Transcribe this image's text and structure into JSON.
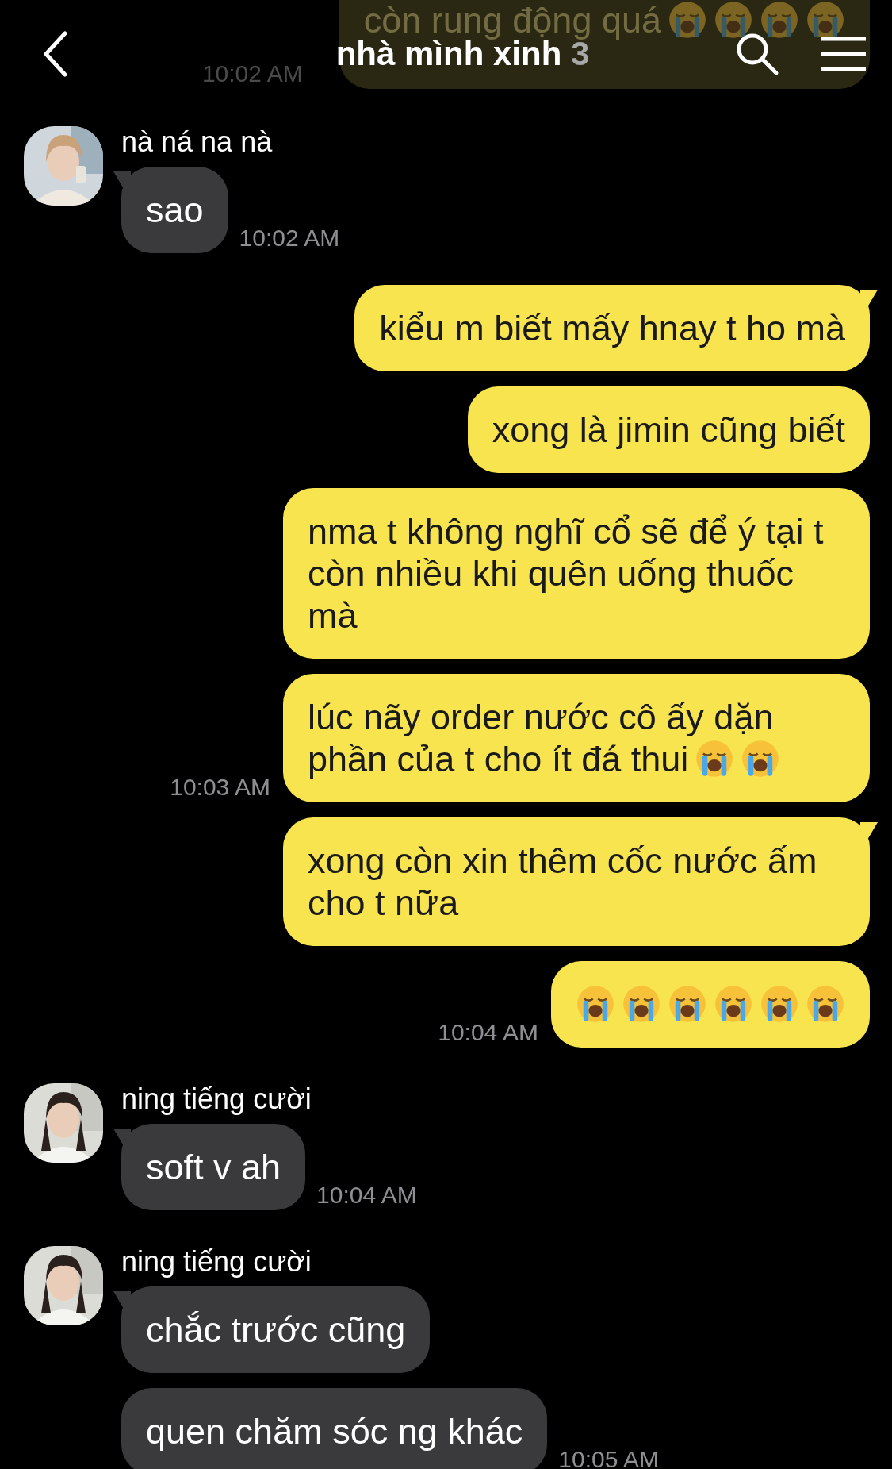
{
  "header": {
    "title": "nhà mình xinh",
    "member_count": "3"
  },
  "messages": [
    {
      "kind": "outgoing",
      "faded": true,
      "tail": false,
      "text": "còn rung động quá",
      "icons": [
        {
          "kind": "crying-face"
        },
        {
          "kind": "crying-face"
        },
        {
          "kind": "crying-face"
        },
        {
          "kind": "crying-face"
        }
      ],
      "time": "10:02 AM"
    },
    {
      "kind": "incoming",
      "faded": false,
      "tail": true,
      "sender": "nà ná na nà",
      "text": "sao",
      "time": "10:02 AM"
    },
    {
      "kind": "outgoing",
      "faded": false,
      "tail": true,
      "text": "kiểu m biết mấy hnay t ho mà"
    },
    {
      "kind": "outgoing",
      "faded": false,
      "tail": false,
      "text": "xong là jimin cũng biết"
    },
    {
      "kind": "outgoing",
      "faded": false,
      "tail": false,
      "text": "nma t không nghĩ cổ sẽ để ý tại t còn nhiều khi quên uống thuốc mà"
    },
    {
      "kind": "outgoing",
      "faded": false,
      "tail": false,
      "text": "lúc nãy order nước cô ấy dặn phần của t cho ít đá thui",
      "icons": [
        {
          "kind": "crying-face"
        },
        {
          "kind": "crying-face"
        }
      ],
      "time": "10:03 AM"
    },
    {
      "kind": "outgoing",
      "faded": false,
      "tail": true,
      "text": "xong còn xin thêm cốc nước ấm cho t nữa"
    },
    {
      "kind": "outgoing",
      "faded": false,
      "tail": false,
      "icons": [
        {
          "kind": "crying-face"
        },
        {
          "kind": "crying-face"
        },
        {
          "kind": "crying-face"
        },
        {
          "kind": "crying-face"
        },
        {
          "kind": "crying-face"
        },
        {
          "kind": "crying-face"
        }
      ],
      "time": "10:04 AM"
    },
    {
      "kind": "incoming",
      "faded": false,
      "tail": true,
      "sender": "ning tiếng cười",
      "text": "soft v ah",
      "time": "10:04 AM"
    },
    {
      "kind": "incoming",
      "faded": false,
      "tail": true,
      "sender": "ning tiếng cười",
      "text": "chắc trước cũng"
    },
    {
      "kind": "incoming",
      "faded": false,
      "tail": false,
      "text": "quen chăm sóc ng khác",
      "time": "10:05 AM"
    }
  ]
}
